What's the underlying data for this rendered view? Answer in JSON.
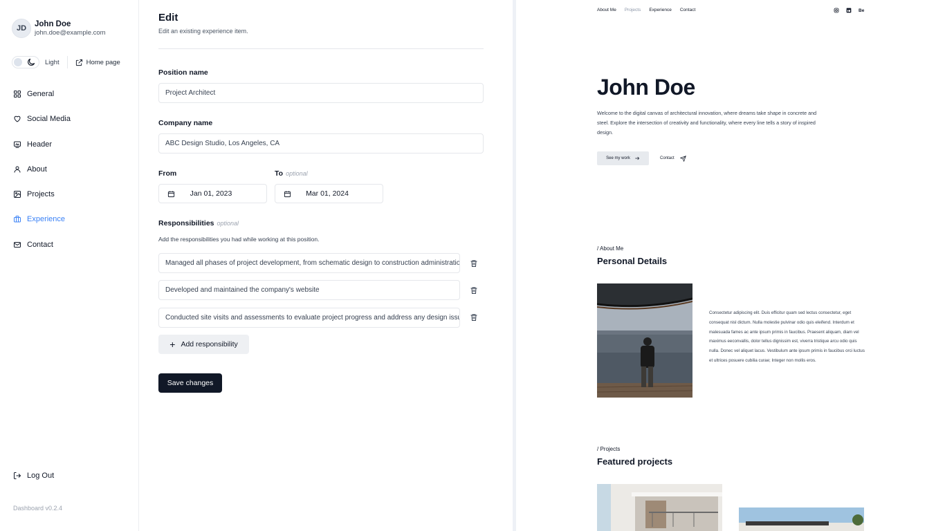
{
  "user": {
    "initials": "JD",
    "name": "John Doe",
    "email": "john.doe@example.com"
  },
  "theme": {
    "label": "Light"
  },
  "home_link": {
    "label": "Home page"
  },
  "nav": {
    "items": [
      {
        "label": "General",
        "icon": "grid-icon",
        "active": false
      },
      {
        "label": "Social Media",
        "icon": "heart-icon",
        "active": false
      },
      {
        "label": "Header",
        "icon": "image-icon",
        "active": false
      },
      {
        "label": "About",
        "icon": "user-icon",
        "active": false
      },
      {
        "label": "Projects",
        "icon": "picture-icon",
        "active": false
      },
      {
        "label": "Experience",
        "icon": "briefcase-icon",
        "active": true
      },
      {
        "label": "Contact",
        "icon": "mail-icon",
        "active": false
      }
    ],
    "active_color": "#3b82f6"
  },
  "logout": {
    "label": "Log Out"
  },
  "version": "Dashboard v0.2.4",
  "editor": {
    "title": "Edit",
    "subtitle": "Edit an existing experience item.",
    "position": {
      "label": "Position name",
      "value": "Project Architect"
    },
    "company": {
      "label": "Company name",
      "value": "ABC Design Studio, Los Angeles, CA"
    },
    "from": {
      "label": "From",
      "value": "Jan 01, 2023"
    },
    "to": {
      "label": "To",
      "optional": "optional",
      "value": "Mar 01, 2024"
    },
    "responsibilities": {
      "label": "Responsibilities",
      "optional": "optional",
      "description": "Add the responsibilities you had while working at this position.",
      "items": [
        "Managed all phases of project development, from schematic design to construction administration",
        "Developed and maintained the company's website",
        "Conducted site visits and assessments to evaluate project progress and address any design issues"
      ]
    },
    "add_button": "Add responsibility",
    "save_button": "Save changes"
  },
  "preview": {
    "nav": [
      "About Me",
      "Projects",
      "Experience",
      "Contact"
    ],
    "social_behance": "Be",
    "hero": {
      "title": "John Doe",
      "text": "Welcome to the digital canvas of architectural innovation, where dreams take shape in concrete and steel. Explore the intersection of creativity and functionality, where every line tells a story of inspired design.",
      "work_button": "See my work",
      "contact_button": "Contact"
    },
    "about": {
      "kicker": "/ About Me",
      "title": "Personal Details",
      "text": "Consectetur adipiscing elit. Duis efficitur quam sed lectus consectetur, eget consequat nisl dictum. Nulla molestie pulvinar odio quis eleifend. Interdum et malesuada fames ac ante ipsum primis in faucibus. Praesent aliquam, diam vel maximus eeconvallis, dolor tellus dignissim est, viverra tristique arcu odio quis nulla. Donec vel aliquet lacus. Vestibulum ante ipsum primis in faucibus orci luctus et ultrices posuere cubilia curae; Integer non mollis eros."
    },
    "projects": {
      "kicker": "/ Projects",
      "title": "Featured projects"
    }
  }
}
